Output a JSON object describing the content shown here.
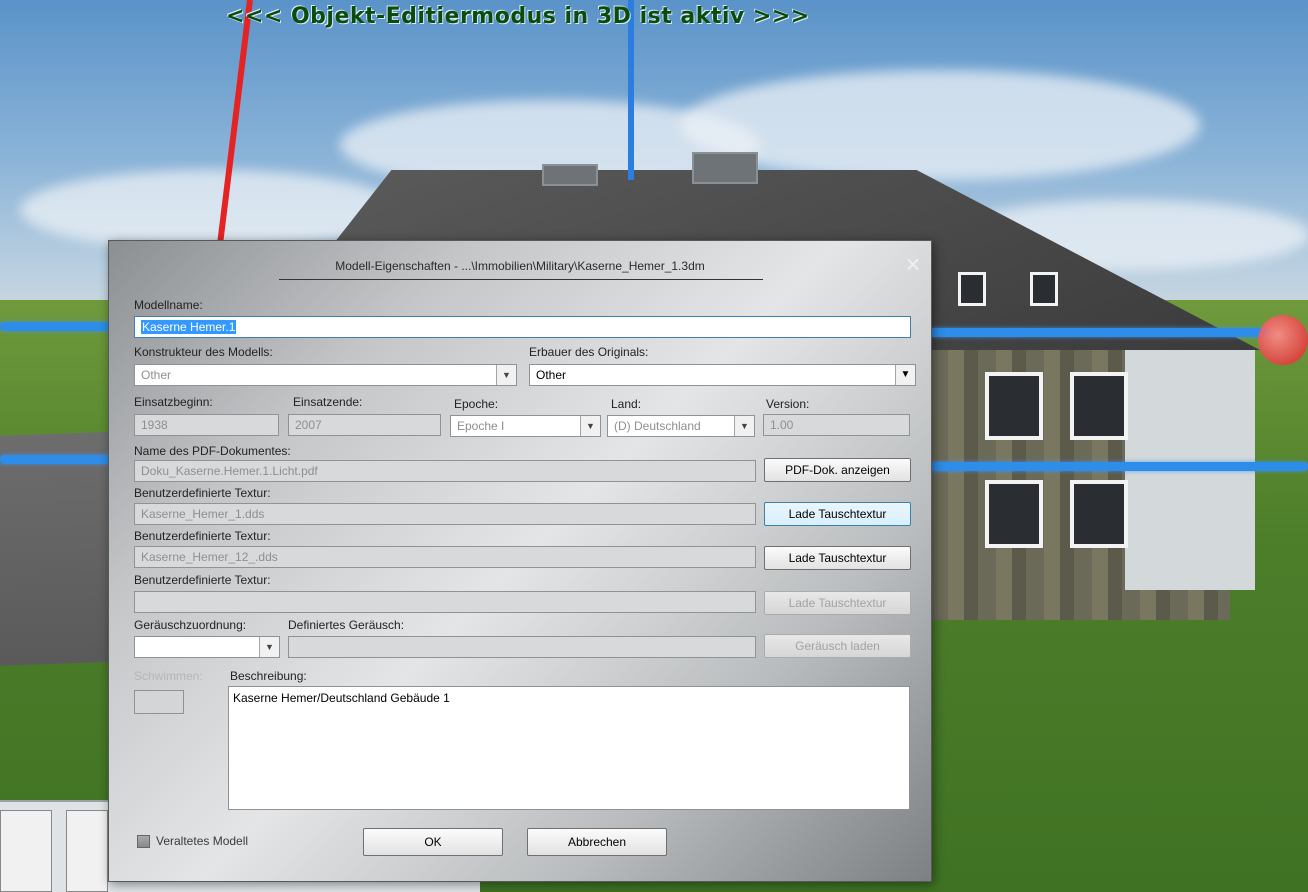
{
  "scene": {
    "mode_banner": "<<<  Objekt-Editiermodus in 3D ist aktiv  >>>"
  },
  "dialog": {
    "title": "Modell-Eigenschaften - ...\\Immobilien\\Military\\Kaserne_Hemer_1.3dm",
    "close_icon": "close-icon",
    "modellname": {
      "label": "Modellname:",
      "value": "Kaserne Hemer.1"
    },
    "konstrukteur": {
      "label": "Konstrukteur des Modells:",
      "value": "Other"
    },
    "erbauer": {
      "label": "Erbauer des Originals:",
      "value": "Other"
    },
    "einsatzbeginn": {
      "label": "Einsatzbeginn:",
      "value": "1938"
    },
    "einsatzende": {
      "label": "Einsatzende:",
      "value": "2007"
    },
    "epoche": {
      "label": "Epoche:",
      "value": "Epoche I"
    },
    "land": {
      "label": "Land:",
      "value": "(D) Deutschland"
    },
    "version": {
      "label": "Version:",
      "value": "1.00"
    },
    "pdf": {
      "label": "Name des PDF-Dokumentes:",
      "value": "Doku_Kaserne.Hemer.1.Licht.pdf",
      "button": "PDF-Dok. anzeigen"
    },
    "textur1": {
      "label": "Benutzerdefinierte Textur:",
      "value": "Kaserne_Hemer_1.dds",
      "button": "Lade Tauschtextur"
    },
    "textur2": {
      "label": "Benutzerdefinierte Textur:",
      "value": "Kaserne_Hemer_12_.dds",
      "button": "Lade Tauschtextur"
    },
    "textur3": {
      "label": "Benutzerdefinierte Textur:",
      "value": "",
      "button": "Lade Tauschtextur"
    },
    "geraeuschzuordnung": {
      "label": "Geräuschzuordnung:",
      "value": ""
    },
    "definiertes_geraeusch": {
      "label": "Definiertes Geräusch:",
      "value": "",
      "button": "Geräusch laden"
    },
    "schwimmen": {
      "label": "Schwimmen:"
    },
    "beschreibung": {
      "label": "Beschreibung:",
      "value": "Kaserne Hemer/Deutschland Gebäude 1"
    },
    "veraltet": {
      "label": "Veraltetes Modell",
      "checked": false
    },
    "ok_button": "OK",
    "cancel_button": "Abbrechen"
  },
  "colors": {
    "selection": "#3399ff",
    "focus_border": "#3c7fb1",
    "banner_text": "#0a4c0a"
  }
}
